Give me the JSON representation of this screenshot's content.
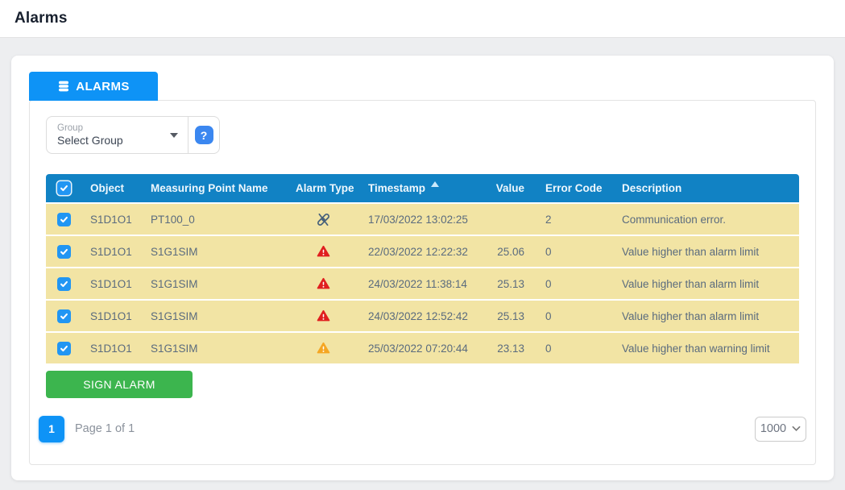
{
  "header": {
    "title": "Alarms"
  },
  "tab": {
    "label": "ALARMS",
    "icon": "database-icon"
  },
  "filters": {
    "group_label": "Group",
    "group_value": "Select Group",
    "help_icon": "?"
  },
  "table": {
    "columns": [
      "Object",
      "Measuring Point Name",
      "Alarm Type",
      "Timestamp",
      "Value",
      "Error Code",
      "Description"
    ],
    "sort": {
      "column": "Timestamp",
      "direction": "ascending"
    },
    "rows": [
      {
        "checked": true,
        "object": "S1D1O1",
        "measuring_point": "PT100_0",
        "alarm_type": "broken-link-icon",
        "timestamp": "17/03/2022 13:02:25",
        "value": "",
        "error_code": "2",
        "description": "Communication error."
      },
      {
        "checked": true,
        "object": "S1D1O1",
        "measuring_point": "S1G1SIM",
        "alarm_type": "red-alarm-icon",
        "timestamp": "22/03/2022 12:22:32",
        "value": "25.06",
        "error_code": "0",
        "description": "Value higher than alarm limit"
      },
      {
        "checked": true,
        "object": "S1D1O1",
        "measuring_point": "S1G1SIM",
        "alarm_type": "red-alarm-icon",
        "timestamp": "24/03/2022 11:38:14",
        "value": "25.13",
        "error_code": "0",
        "description": "Value higher than alarm limit"
      },
      {
        "checked": true,
        "object": "S1D1O1",
        "measuring_point": "S1G1SIM",
        "alarm_type": "red-alarm-icon",
        "timestamp": "24/03/2022 12:52:42",
        "value": "25.13",
        "error_code": "0",
        "description": "Value higher than alarm limit"
      },
      {
        "checked": true,
        "object": "S1D1O1",
        "measuring_point": "S1G1SIM",
        "alarm_type": "orange-warning-icon",
        "timestamp": "25/03/2022 07:20:44",
        "value": "23.13",
        "error_code": "0",
        "description": "Value higher than warning limit"
      }
    ]
  },
  "actions": {
    "sign_alarm_label": "SIGN ALARM"
  },
  "pagination": {
    "current_page": "1",
    "page_info": "Page 1 of 1",
    "page_size": "1000"
  },
  "colors": {
    "tab_blue": "#0e93f6",
    "table_header_blue": "#1182c4",
    "row_yellow": "#f2e4a4",
    "sign_green": "#3cb54e",
    "checkbox_blue": "#2196f3",
    "help_blue": "#3b87f0",
    "alarm_red": "#e01f1f",
    "warning_orange": "#f5a623",
    "row_text": "#5a6b7e"
  }
}
